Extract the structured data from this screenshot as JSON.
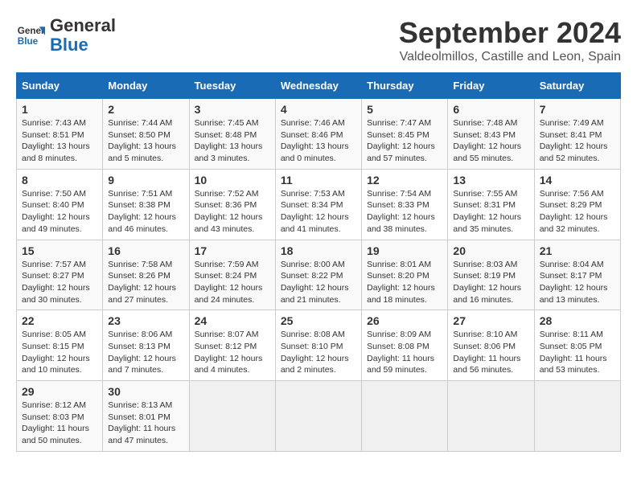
{
  "header": {
    "logo_text_general": "General",
    "logo_text_blue": "Blue",
    "month_title": "September 2024",
    "location": "Valdeolmillos, Castille and Leon, Spain"
  },
  "days_of_week": [
    "Sunday",
    "Monday",
    "Tuesday",
    "Wednesday",
    "Thursday",
    "Friday",
    "Saturday"
  ],
  "weeks": [
    [
      {
        "day": "1",
        "sunrise": "7:43 AM",
        "sunset": "8:51 PM",
        "daylight": "13 hours and 8 minutes."
      },
      {
        "day": "2",
        "sunrise": "7:44 AM",
        "sunset": "8:50 PM",
        "daylight": "13 hours and 5 minutes."
      },
      {
        "day": "3",
        "sunrise": "7:45 AM",
        "sunset": "8:48 PM",
        "daylight": "13 hours and 3 minutes."
      },
      {
        "day": "4",
        "sunrise": "7:46 AM",
        "sunset": "8:46 PM",
        "daylight": "13 hours and 0 minutes."
      },
      {
        "day": "5",
        "sunrise": "7:47 AM",
        "sunset": "8:45 PM",
        "daylight": "12 hours and 57 minutes."
      },
      {
        "day": "6",
        "sunrise": "7:48 AM",
        "sunset": "8:43 PM",
        "daylight": "12 hours and 55 minutes."
      },
      {
        "day": "7",
        "sunrise": "7:49 AM",
        "sunset": "8:41 PM",
        "daylight": "12 hours and 52 minutes."
      }
    ],
    [
      {
        "day": "8",
        "sunrise": "7:50 AM",
        "sunset": "8:40 PM",
        "daylight": "12 hours and 49 minutes."
      },
      {
        "day": "9",
        "sunrise": "7:51 AM",
        "sunset": "8:38 PM",
        "daylight": "12 hours and 46 minutes."
      },
      {
        "day": "10",
        "sunrise": "7:52 AM",
        "sunset": "8:36 PM",
        "daylight": "12 hours and 43 minutes."
      },
      {
        "day": "11",
        "sunrise": "7:53 AM",
        "sunset": "8:34 PM",
        "daylight": "12 hours and 41 minutes."
      },
      {
        "day": "12",
        "sunrise": "7:54 AM",
        "sunset": "8:33 PM",
        "daylight": "12 hours and 38 minutes."
      },
      {
        "day": "13",
        "sunrise": "7:55 AM",
        "sunset": "8:31 PM",
        "daylight": "12 hours and 35 minutes."
      },
      {
        "day": "14",
        "sunrise": "7:56 AM",
        "sunset": "8:29 PM",
        "daylight": "12 hours and 32 minutes."
      }
    ],
    [
      {
        "day": "15",
        "sunrise": "7:57 AM",
        "sunset": "8:27 PM",
        "daylight": "12 hours and 30 minutes."
      },
      {
        "day": "16",
        "sunrise": "7:58 AM",
        "sunset": "8:26 PM",
        "daylight": "12 hours and 27 minutes."
      },
      {
        "day": "17",
        "sunrise": "7:59 AM",
        "sunset": "8:24 PM",
        "daylight": "12 hours and 24 minutes."
      },
      {
        "day": "18",
        "sunrise": "8:00 AM",
        "sunset": "8:22 PM",
        "daylight": "12 hours and 21 minutes."
      },
      {
        "day": "19",
        "sunrise": "8:01 AM",
        "sunset": "8:20 PM",
        "daylight": "12 hours and 18 minutes."
      },
      {
        "day": "20",
        "sunrise": "8:03 AM",
        "sunset": "8:19 PM",
        "daylight": "12 hours and 16 minutes."
      },
      {
        "day": "21",
        "sunrise": "8:04 AM",
        "sunset": "8:17 PM",
        "daylight": "12 hours and 13 minutes."
      }
    ],
    [
      {
        "day": "22",
        "sunrise": "8:05 AM",
        "sunset": "8:15 PM",
        "daylight": "12 hours and 10 minutes."
      },
      {
        "day": "23",
        "sunrise": "8:06 AM",
        "sunset": "8:13 PM",
        "daylight": "12 hours and 7 minutes."
      },
      {
        "day": "24",
        "sunrise": "8:07 AM",
        "sunset": "8:12 PM",
        "daylight": "12 hours and 4 minutes."
      },
      {
        "day": "25",
        "sunrise": "8:08 AM",
        "sunset": "8:10 PM",
        "daylight": "12 hours and 2 minutes."
      },
      {
        "day": "26",
        "sunrise": "8:09 AM",
        "sunset": "8:08 PM",
        "daylight": "11 hours and 59 minutes."
      },
      {
        "day": "27",
        "sunrise": "8:10 AM",
        "sunset": "8:06 PM",
        "daylight": "11 hours and 56 minutes."
      },
      {
        "day": "28",
        "sunrise": "8:11 AM",
        "sunset": "8:05 PM",
        "daylight": "11 hours and 53 minutes."
      }
    ],
    [
      {
        "day": "29",
        "sunrise": "8:12 AM",
        "sunset": "8:03 PM",
        "daylight": "11 hours and 50 minutes."
      },
      {
        "day": "30",
        "sunrise": "8:13 AM",
        "sunset": "8:01 PM",
        "daylight": "11 hours and 47 minutes."
      },
      null,
      null,
      null,
      null,
      null
    ]
  ]
}
